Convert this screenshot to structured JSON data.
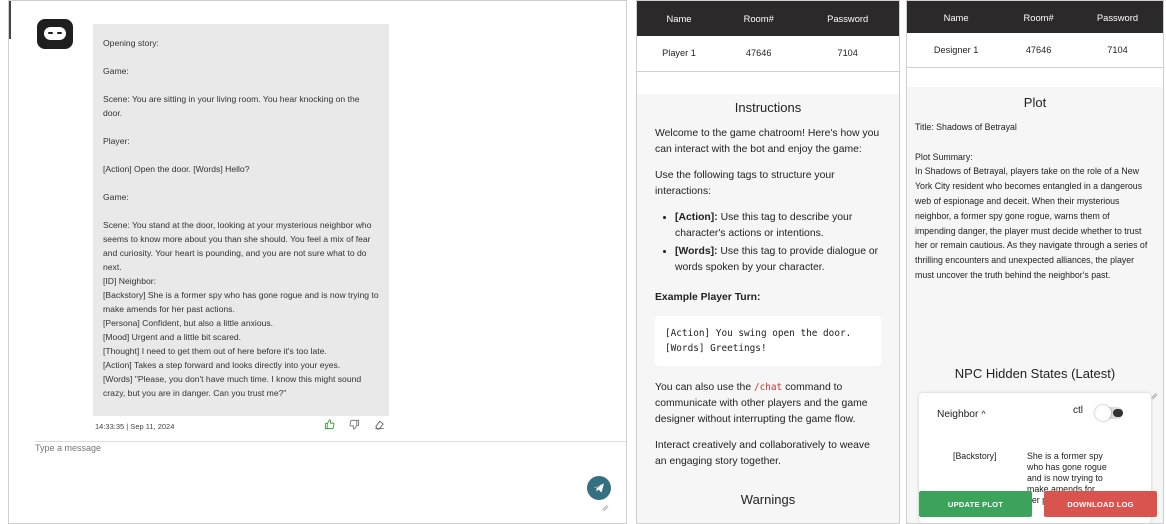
{
  "chat": {
    "message": "Opening story:\n\nGame:\n\nScene: You are sitting in your living room. You hear knocking on the door.\n\nPlayer:\n\n[Action] Open the door. [Words] Hello?\n\nGame:\n\nScene: You stand at the door, looking at your mysterious neighbor who seems to know more about you than she should. You feel a mix of fear and curiosity. Your heart is pounding, and you are not sure what to do next.\n[ID] Neighbor:\n[Backstory] She is a former spy who has gone rogue and is now trying to make amends for her past actions.\n[Persona] Confident, but also a little anxious.\n[Mood] Urgent and a little bit scared.\n[Thought] I need to get them out of here before it's too late.\n[Action] Takes a step forward and looks directly into your eyes.\n[Words] \"Please, you don't have much time. I know this might sound crazy, but you are in danger. Can you trust me?\"",
    "timestamp": "14:33:35 | Sep 11, 2024",
    "input_placeholder": "Type a message",
    "like_icon": "👍",
    "dislike_icon": "👎",
    "erase_icon": "⌫"
  },
  "player": {
    "headers": [
      "Name",
      "Room#",
      "Password"
    ],
    "row": [
      "Player 1",
      "47646",
      "7104"
    ],
    "instructions_title": "Instructions",
    "intro": "Welcome to the game chatroom! Here's how you can interact with the bot and enjoy the game:",
    "tags_intro": "Use the following tags to structure your interactions:",
    "action_tag": "[Action]:",
    "action_desc": " Use this tag to describe your character's actions or intentions.",
    "words_tag": "[Words]:",
    "words_desc": " Use this tag to provide dialogue or words spoken by your character.",
    "example_title": "Example Player Turn:",
    "example_code": "[Action] You swing open the door.\n[Words] Greetings!",
    "chat_cmd_pre": "You can also use the ",
    "chat_cmd": "/chat",
    "chat_cmd_post": " command to communicate with other players and the game designer without interrupting the game flow.",
    "closing": "Interact creatively and collaboratively to weave an engaging story together.",
    "warnings_title": "Warnings"
  },
  "designer": {
    "headers": [
      "Name",
      "Room#",
      "Password"
    ],
    "row": [
      "Designer 1",
      "47646",
      "7104"
    ],
    "plot_title": "Plot",
    "plot_text": "Title: Shadows of Betrayal\n\nPlot Summary:\nIn Shadows of Betrayal, players take on the role of a New York City resident who becomes entangled in a dangerous web of espionage and deceit. When their mysterious neighbor, a former spy gone rogue, warns them of impending danger, the player must decide whether to trust her or remain cautious. As they navigate through a series of thrilling encounters and unexpected alliances, the player must uncover the truth behind the neighbor's past.",
    "npc_title": "NPC Hidden States (Latest)",
    "npc_name": "Neighbor",
    "npc_chevron": "^",
    "ctl_label": "ctl",
    "npc_key": "[Backstory]",
    "npc_value": "She is a former spy who has gone rogue and is now trying to make amends for her past actions.",
    "update_btn": "UPDATE PLOT",
    "download_btn": "DOWNLOAD LOG"
  },
  "colors": {
    "header_bg": "#2b2929",
    "send_button": "#356f82",
    "update_button": "#3ca35c",
    "download_button": "#d9534f"
  }
}
